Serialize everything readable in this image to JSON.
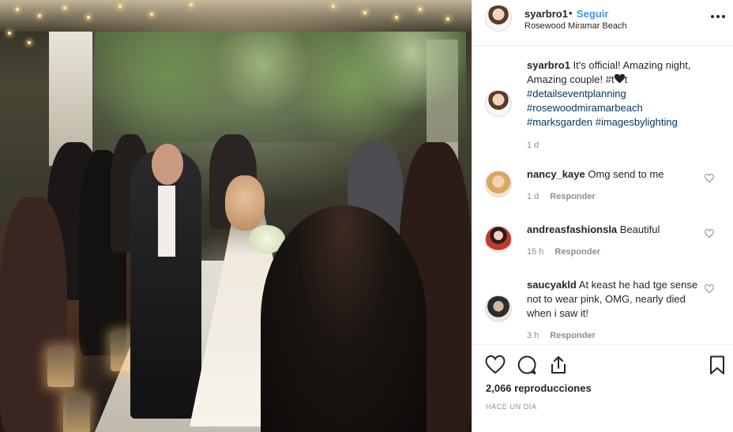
{
  "post": {
    "username": "syarbro1",
    "dot": "•",
    "follow_label": "Seguir",
    "location": "Rosewood Miramar Beach",
    "more_icon": "more-options-icon"
  },
  "caption": {
    "username": "syarbro1",
    "text_1": "It's official! Amazing night, Amazing couple! #t",
    "heart_icon": "black-heart-emoji",
    "text_2": "t",
    "hashtags": [
      "#detailseventplanning",
      "#rosewoodmiramarbeach",
      "#marksgarden",
      "#imagesbylighting"
    ],
    "time": "1 d"
  },
  "comments": [
    {
      "username": "nancy_kaye",
      "text": "Omg send to me",
      "time": "1 d",
      "reply_label": "Responder",
      "avatar_color": "#d9a75e"
    },
    {
      "username": "andreasfashionsla",
      "text": "Beautiful",
      "time": "15 h",
      "reply_label": "Responder",
      "avatar_color": "#c0392b"
    },
    {
      "username": "saucyakld",
      "text": "At keast he had tge sense not to wear pink, OMG, nearly died when i saw it!",
      "time": "3 h",
      "reply_label": "Responder",
      "avatar_color": "#2c2c2c"
    }
  ],
  "actions": {
    "like_icon": "heart-outline-icon",
    "comment_icon": "comment-icon",
    "share_icon": "share-icon",
    "save_icon": "bookmark-icon",
    "views": "2,066 reproducciones",
    "posted": "HACE UN DÍA"
  },
  "colors": {
    "link_blue": "#3897f0",
    "hashtag": "#003569",
    "muted": "#8e8e8e",
    "text": "#262626"
  }
}
